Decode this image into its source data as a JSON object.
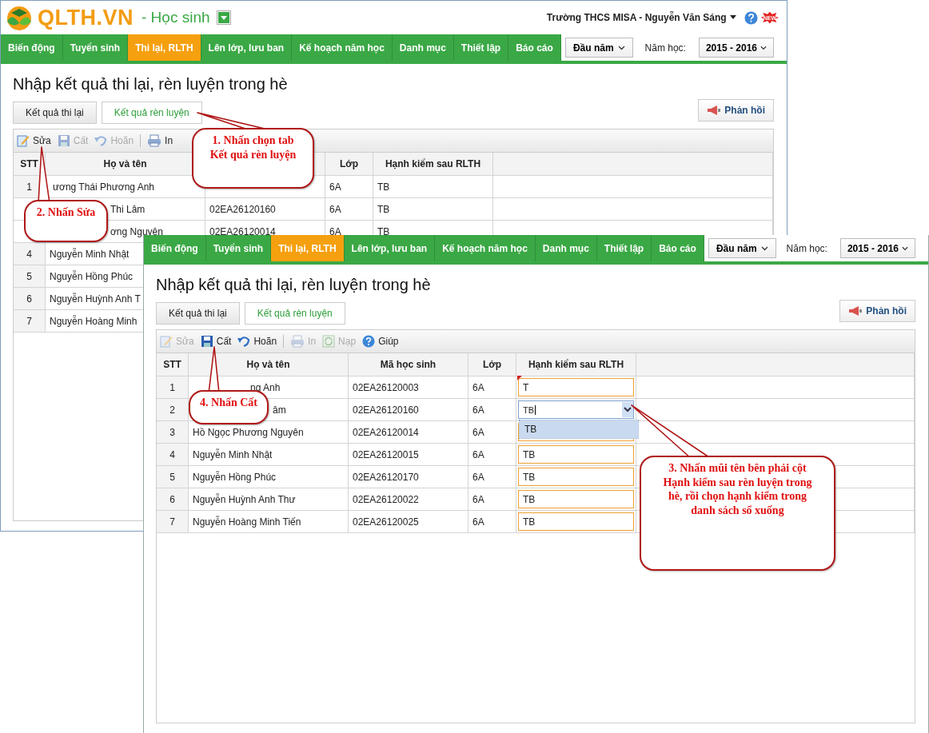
{
  "back_window": {
    "header": {
      "logo": "QLTH.VN",
      "role": "- Học sinh",
      "user": "Trường THCS MISA - Nguyễn Văn Sáng",
      "badge": "NEW"
    },
    "nav": [
      {
        "label": "Biến động",
        "selected": false
      },
      {
        "label": "Tuyển sinh",
        "selected": false
      },
      {
        "label": "Thi lại, RLTH",
        "selected": true
      },
      {
        "label": "Lên lớp, lưu ban",
        "selected": false
      },
      {
        "label": "Kế hoạch năm học",
        "selected": false
      },
      {
        "label": "Danh mục",
        "selected": false
      },
      {
        "label": "Thiết lập",
        "selected": false
      },
      {
        "label": "Báo cáo",
        "selected": false
      }
    ],
    "term": "Đầu năm",
    "year_label": "Năm học:",
    "year": "2015 - 2016",
    "title": "Nhập kết quả thi lại, rèn luyện trong hè",
    "tabs": [
      {
        "label": "Kết quả thi lại",
        "selected": false
      },
      {
        "label": "Kết quả rèn luyện",
        "selected": true
      }
    ],
    "feedback": "Phản hồi",
    "toolbar": [
      {
        "kind": "edit",
        "label": "Sửa",
        "disabled": false
      },
      {
        "kind": "save",
        "label": "Cất",
        "disabled": true
      },
      {
        "kind": "undo",
        "label": "Hoãn",
        "disabled": true
      },
      {
        "kind": "print",
        "label": "In",
        "disabled": false
      }
    ],
    "headers": {
      "stt": "STT",
      "name": "Họ và tên",
      "class": "Lớp",
      "conduct": "Hạnh kiểm sau RLTH"
    },
    "rows": [
      {
        "stt": "1",
        "name": "ương Thái Phương Anh",
        "class": "6A",
        "conduct": "TB"
      },
      {
        "name": "Thi Lâm",
        "code": "02EA26120160",
        "class": "6A",
        "conduct": "TB"
      },
      {
        "name": "ơng Nguyên",
        "code": "02EA26120014",
        "class": "6A",
        "conduct": "TB"
      },
      {
        "stt": "4",
        "name": "Nguyễn Minh Nhật"
      },
      {
        "stt": "5",
        "name": "Nguyễn Hồng Phúc"
      },
      {
        "stt": "6",
        "name": "Nguyễn Huỳnh Anh T"
      },
      {
        "stt": "7",
        "name": "Nguyễn Hoàng Minh"
      }
    ]
  },
  "front_window": {
    "nav": [
      {
        "label": "Biến động",
        "selected": false
      },
      {
        "label": "Tuyển sinh",
        "selected": false
      },
      {
        "label": "Thi lại, RLTH",
        "selected": true
      },
      {
        "label": "Lên lớp, lưu ban",
        "selected": false
      },
      {
        "label": "Kế hoạch năm học",
        "selected": false
      },
      {
        "label": "Danh mục",
        "selected": false
      },
      {
        "label": "Thiết lập",
        "selected": false
      },
      {
        "label": "Báo cáo",
        "selected": false
      }
    ],
    "term": "Đầu năm",
    "year_label": "Năm học:",
    "year": "2015 - 2016",
    "title": "Nhập kết quả thi lại, rèn luyện trong hè",
    "tabs": [
      {
        "label": "Kết quả thi lại",
        "selected": false
      },
      {
        "label": "Kết quả rèn luyện",
        "selected": true
      }
    ],
    "feedback": "Phản hồi",
    "toolbar": [
      {
        "kind": "edit",
        "label": "Sửa",
        "disabled": true
      },
      {
        "kind": "save",
        "label": "Cất",
        "disabled": false
      },
      {
        "kind": "undo",
        "label": "Hoãn",
        "disabled": false
      },
      {
        "kind": "print",
        "label": "In",
        "disabled": true
      },
      {
        "kind": "reload",
        "label": "Nạp",
        "disabled": true
      },
      {
        "kind": "help",
        "label": "Giúp",
        "disabled": false
      }
    ],
    "headers": {
      "stt": "STT",
      "name": "Họ và tên",
      "code": "Mã học sinh",
      "class": "Lớp",
      "conduct": "Hạnh kiểm sau RLTH"
    },
    "rows": [
      {
        "stt": "1",
        "name": "ng Anh",
        "code": "02EA26120003",
        "class": "6A",
        "conduct": {
          "kind": "input",
          "value": "T",
          "changed": true
        }
      },
      {
        "stt": "2",
        "name": "âm",
        "code": "02EA26120160",
        "class": "6A",
        "conduct": {
          "kind": "combo",
          "value": "TB",
          "expanded": true,
          "options": [
            {
              "label": "TB",
              "selected": true
            }
          ]
        }
      },
      {
        "stt": "3",
        "name": "Hồ Ngọc Phương Nguyên",
        "code": "02EA26120014",
        "class": "6A",
        "conduct": {
          "kind": "input"
        }
      },
      {
        "stt": "4",
        "name": "Nguyễn Minh Nhật",
        "code": "02EA26120015",
        "class": "6A",
        "conduct": {
          "kind": "input",
          "value": "TB"
        }
      },
      {
        "stt": "5",
        "name": "Nguyễn Hồng Phúc",
        "code": "02EA26120170",
        "class": "6A",
        "conduct": {
          "kind": "input",
          "value": "TB"
        }
      },
      {
        "stt": "6",
        "name": "Nguyễn Huỳnh Anh Thư",
        "code": "02EA26120022",
        "class": "6A",
        "conduct": {
          "kind": "input",
          "value": "TB"
        }
      },
      {
        "stt": "7",
        "name": "Nguyễn Hoàng Minh Tiến",
        "code": "02EA26120025",
        "class": "6A",
        "conduct": {
          "kind": "input",
          "value": "TB"
        }
      }
    ]
  },
  "callouts": [
    {
      "text": "1. Nhấn chọn tab\nKết quả rèn luyện"
    },
    {
      "text": "2. Nhấn Sửa"
    },
    {
      "text": "3. Nhấn mũi tên bên phải cột\nHạnh kiểm sau rèn luyện trong\nhè, rồi chọn hạnh kiểm trong\ndanh sách sổ xuống"
    },
    {
      "text": "4. Nhấn Cất"
    }
  ]
}
